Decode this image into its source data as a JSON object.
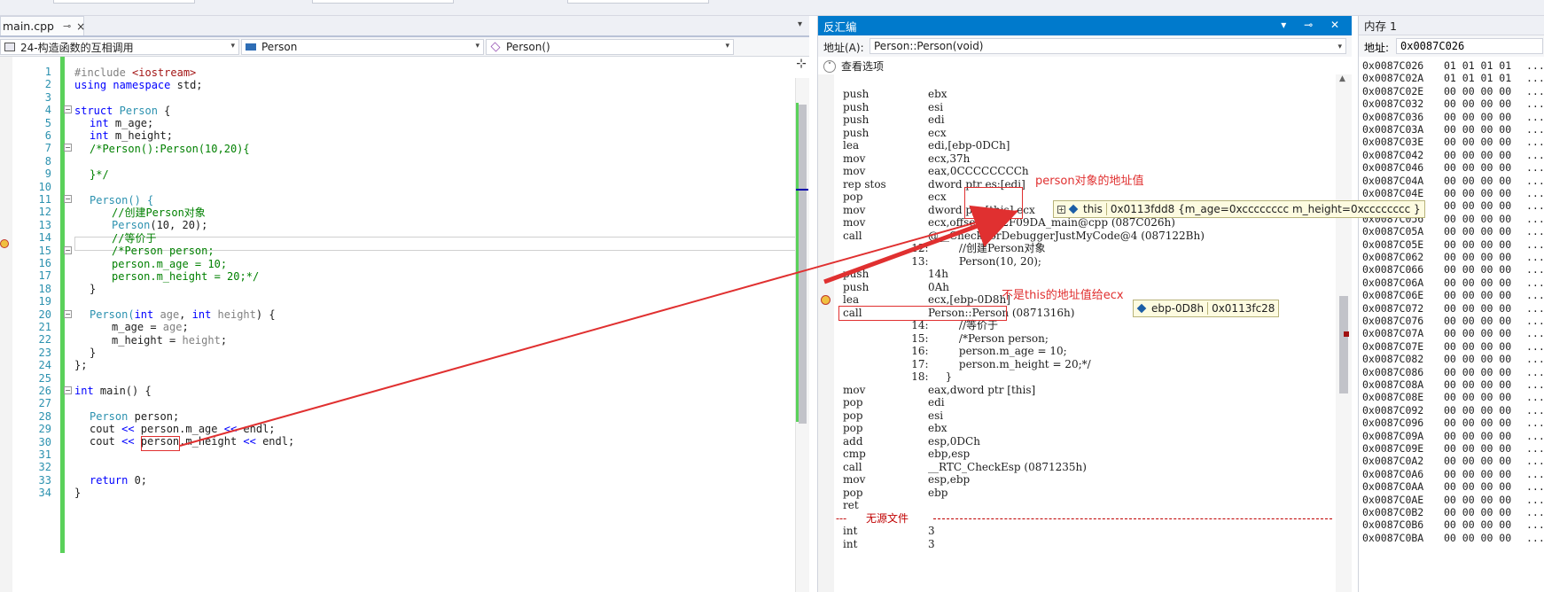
{
  "editor": {
    "tab_label": "main.cpp",
    "tab_pin": "⊸",
    "tab_close": "×",
    "nav_project": "24-构造函数的互相调用",
    "nav_class": "Person",
    "nav_member": "Person()",
    "line_numbers": [
      "1",
      "2",
      "3",
      "4",
      "5",
      "6",
      "7",
      "8",
      "9",
      "10",
      "11",
      "12",
      "13",
      "14",
      "15",
      "16",
      "17",
      "18",
      "19",
      "20",
      "21",
      "22",
      "23",
      "24",
      "25",
      "26",
      "27",
      "28",
      "29",
      "30",
      "31",
      "32",
      "33",
      "34"
    ]
  },
  "disasm": {
    "title": "反汇编",
    "title_buttons": "▾ ⊸ ✕",
    "address_label": "地址(A):",
    "address_value": "Person::Person(void)",
    "view_options": "查看选项",
    "separator_label": "无源文件"
  },
  "memory": {
    "title": "内存 1",
    "address_label": "地址:",
    "address_value": "0x0087C026",
    "rows": [
      {
        "addr": "0x0087C026",
        "bytes": "01 01 01 01",
        "ascii": "...."
      },
      {
        "addr": "0x0087C02A",
        "bytes": "01 01 01 01",
        "ascii": "...."
      },
      {
        "addr": "0x0087C02E",
        "bytes": "00 00 00 00",
        "ascii": "...."
      },
      {
        "addr": "0x0087C032",
        "bytes": "00 00 00 00",
        "ascii": "...."
      },
      {
        "addr": "0x0087C036",
        "bytes": "00 00 00 00",
        "ascii": "...."
      },
      {
        "addr": "0x0087C03A",
        "bytes": "00 00 00 00",
        "ascii": "...."
      },
      {
        "addr": "0x0087C03E",
        "bytes": "00 00 00 00",
        "ascii": "...."
      },
      {
        "addr": "0x0087C042",
        "bytes": "00 00 00 00",
        "ascii": "...."
      },
      {
        "addr": "0x0087C046",
        "bytes": "00 00 00 00",
        "ascii": "...."
      },
      {
        "addr": "0x0087C04A",
        "bytes": "00 00 00 00",
        "ascii": "...."
      },
      {
        "addr": "0x0087C04E",
        "bytes": "00 00 00 00",
        "ascii": "...."
      },
      {
        "addr": "0x0087C052",
        "bytes": "00 00 00 00",
        "ascii": "...."
      },
      {
        "addr": "0x0087C056",
        "bytes": "00 00 00 00",
        "ascii": "...."
      },
      {
        "addr": "0x0087C05A",
        "bytes": "00 00 00 00",
        "ascii": "...."
      },
      {
        "addr": "0x0087C05E",
        "bytes": "00 00 00 00",
        "ascii": "...."
      },
      {
        "addr": "0x0087C062",
        "bytes": "00 00 00 00",
        "ascii": "...."
      },
      {
        "addr": "0x0087C066",
        "bytes": "00 00 00 00",
        "ascii": "...."
      },
      {
        "addr": "0x0087C06A",
        "bytes": "00 00 00 00",
        "ascii": "...."
      },
      {
        "addr": "0x0087C06E",
        "bytes": "00 00 00 00",
        "ascii": "...."
      },
      {
        "addr": "0x0087C072",
        "bytes": "00 00 00 00",
        "ascii": "...."
      },
      {
        "addr": "0x0087C076",
        "bytes": "00 00 00 00",
        "ascii": "...."
      },
      {
        "addr": "0x0087C07A",
        "bytes": "00 00 00 00",
        "ascii": "...."
      },
      {
        "addr": "0x0087C07E",
        "bytes": "00 00 00 00",
        "ascii": "...."
      },
      {
        "addr": "0x0087C082",
        "bytes": "00 00 00 00",
        "ascii": "...."
      },
      {
        "addr": "0x0087C086",
        "bytes": "00 00 00 00",
        "ascii": "...."
      },
      {
        "addr": "0x0087C08A",
        "bytes": "00 00 00 00",
        "ascii": "...."
      },
      {
        "addr": "0x0087C08E",
        "bytes": "00 00 00 00",
        "ascii": "...."
      },
      {
        "addr": "0x0087C092",
        "bytes": "00 00 00 00",
        "ascii": "...."
      },
      {
        "addr": "0x0087C096",
        "bytes": "00 00 00 00",
        "ascii": "...."
      },
      {
        "addr": "0x0087C09A",
        "bytes": "00 00 00 00",
        "ascii": "...."
      },
      {
        "addr": "0x0087C09E",
        "bytes": "00 00 00 00",
        "ascii": "...."
      },
      {
        "addr": "0x0087C0A2",
        "bytes": "00 00 00 00",
        "ascii": "...."
      },
      {
        "addr": "0x0087C0A6",
        "bytes": "00 00 00 00",
        "ascii": "...."
      },
      {
        "addr": "0x0087C0AA",
        "bytes": "00 00 00 00",
        "ascii": "...."
      },
      {
        "addr": "0x0087C0AE",
        "bytes": "00 00 00 00",
        "ascii": "...."
      },
      {
        "addr": "0x0087C0B2",
        "bytes": "00 00 00 00",
        "ascii": "...."
      },
      {
        "addr": "0x0087C0B6",
        "bytes": "00 00 00 00",
        "ascii": "...."
      },
      {
        "addr": "0x0087C0BA",
        "bytes": "00 00 00 00",
        "ascii": "...."
      }
    ]
  },
  "code": {
    "l1_pp": "#include ",
    "l1_inc": "<iostream>",
    "l2_kw1": "using",
    "l2_kw2": "namespace",
    "l2_rest": " std;",
    "l4_kw": "struct",
    "l4_ty": "Person",
    "l4_rest": " {",
    "l5_kw": "int",
    "l5_rest": " m_age;",
    "l6_kw": "int",
    "l6_rest": " m_height;",
    "l7_cm": "/*Person():Person(10,20){",
    "l9_cm": "}*/",
    "l11": "Person() {",
    "l12_cm": "//创建Person对象",
    "l13_ty": "Person",
    "l13_rest": "(10, 20);",
    "l14_cm": "//等价于",
    "l15_cm": "/*Person person;",
    "l16_cm": "person.m_age = 10;",
    "l17_cm": "person.m_height = 20;*/",
    "l18": "}",
    "l20_a": "Person(",
    "l20_kw1": "int",
    "l20_p1": " age",
    "l20_c": ", ",
    "l20_kw2": "int",
    "l20_p2": " height",
    "l20_d": ") {",
    "l21_a": "m_age = ",
    "l21_p": "age",
    "l21_b": ";",
    "l22_a": "m_height = ",
    "l22_p": "height",
    "l22_b": ";",
    "l23": "}",
    "l24": "};",
    "l26_kw": "int",
    "l26_rest": " main() {",
    "l28_ty": "Person",
    "l28_var": "person",
    "l28_end": ";",
    "l29_a": "cout ",
    "l29_op1": "<<",
    "l29_b": " person.m_age ",
    "l29_op2": "<<",
    "l29_c": " endl;",
    "l30_a": "cout ",
    "l30_op1": "<<",
    "l30_b": " person.m_height ",
    "l30_op2": "<<",
    "l30_c": " endl;",
    "l33_kw": "return",
    "l33_rest": " 0;",
    "l34": "}"
  },
  "asm": [
    {
      "op": "push",
      "arg": "ebx"
    },
    {
      "op": "push",
      "arg": "esi"
    },
    {
      "op": "push",
      "arg": "edi"
    },
    {
      "op": "push",
      "arg": "ecx"
    },
    {
      "op": "lea",
      "arg": "edi,[ebp-0DCh]"
    },
    {
      "op": "mov",
      "arg": "ecx,37h"
    },
    {
      "op": "mov",
      "arg": "eax,0CCCCCCCCh"
    },
    {
      "op": "rep stos",
      "arg": "dword ptr es:[edi]"
    },
    {
      "op": "pop",
      "arg": "ecx"
    },
    {
      "op": "mov",
      "arg": "dword ptr [this],ecx"
    },
    {
      "op": "mov",
      "arg": "ecx,offset _062F09DA_main@cpp (087C026h)"
    },
    {
      "op": "call",
      "arg": "@__CheckForDebuggerJustMyCode@4 (087122Bh)"
    },
    {
      "src": "    12:         //创建Person对象"
    },
    {
      "src": "    13:         Person(10, 20);"
    },
    {
      "op": "push",
      "arg": "14h"
    },
    {
      "op": "push",
      "arg": "0Ah"
    },
    {
      "op": "lea",
      "arg": "ecx,[ebp-0D8h]"
    },
    {
      "op": "call",
      "arg": "Person::Person (0871316h)"
    },
    {
      "src": "    14:         //等价于"
    },
    {
      "src": "    15:         /*Person person;"
    },
    {
      "src": "    16:         person.m_age = 10;"
    },
    {
      "src": "    17:         person.m_height = 20;*/"
    },
    {
      "src": "    18:     }"
    },
    {
      "op": "mov",
      "arg": "eax,dword ptr [this]"
    },
    {
      "op": "pop",
      "arg": "edi"
    },
    {
      "op": "pop",
      "arg": "esi"
    },
    {
      "op": "pop",
      "arg": "ebx"
    },
    {
      "op": "add",
      "arg": "esp,0DCh"
    },
    {
      "op": "cmp",
      "arg": "ebp,esp"
    },
    {
      "op": "call",
      "arg": "__RTC_CheckEsp (0871235h)"
    },
    {
      "op": "mov",
      "arg": "esp,ebp"
    },
    {
      "op": "pop",
      "arg": "ebp"
    },
    {
      "op": "ret",
      "arg": ""
    }
  ],
  "asm_tail": [
    {
      "op": "int",
      "arg": "3"
    },
    {
      "op": "int",
      "arg": "3"
    }
  ],
  "annotations": {
    "note1": "person对象的地址值",
    "note2": "不是this的地址值给ecx",
    "tip_this_name": "this",
    "tip_this_value": "0x0113fdd8 {m_age=0xcccccccc m_height=0xcccccccc }",
    "tip_ebp_name": "ebp-0D8h",
    "tip_ebp_value": "0x0113fc28"
  },
  "colors": {
    "accent": "#007acc",
    "annotation_red": "#e03030",
    "change_green": "#5ad15a"
  }
}
